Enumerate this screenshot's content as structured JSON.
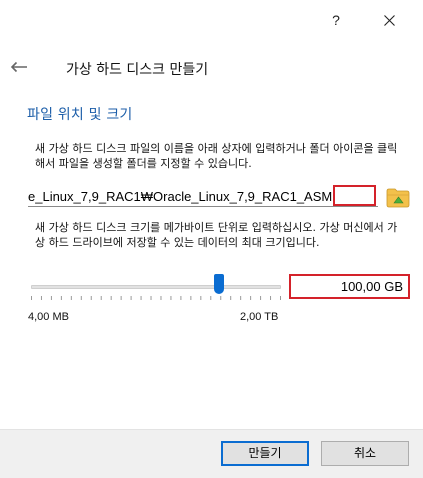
{
  "titlebar": {
    "help_label": "?",
    "close_label": "X"
  },
  "header": {
    "title": "가상 하드 디스크 만들기"
  },
  "section": {
    "title": "파일 위치 및 크기"
  },
  "location": {
    "description": "새 가상 하드 디스크 파일의 이름을 아래 상자에 입력하거나 폴더 아이콘을 클릭해서 파일을 생성할 폴더를 지정할 수 있습니다.",
    "path_value": "e_Linux_7,9_RAC1₩Oracle_Linux_7,9_RAC1_ASM"
  },
  "size": {
    "description": "새 가상 하드 디스크 크기를 메가바이트 단위로 입력하십시오. 가상 머신에서 가상 하드 드라이브에 저장할 수 있는 데이터의 최대 크기입니다.",
    "value": "100,00 GB",
    "min_label": "4,00 MB",
    "max_label": "2,00 TB",
    "slider_fraction": 0.75
  },
  "footer": {
    "create_label": "만들기",
    "cancel_label": "취소"
  },
  "colors": {
    "accent": "#0a6cd1",
    "section_title": "#1c5ea9",
    "highlight_red": "#d4222a"
  }
}
